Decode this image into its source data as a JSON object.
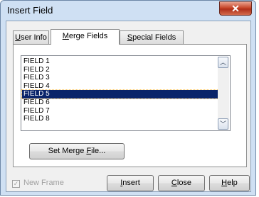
{
  "dialog": {
    "title": "Insert Field",
    "close_glyph": "✕"
  },
  "tabs": [
    {
      "label_ul": "U",
      "label_rest": "ser Info",
      "active": false
    },
    {
      "label_ul": "M",
      "label_rest": "erge Fields",
      "active": true
    },
    {
      "label_ul": "S",
      "label_rest": "pecial Fields",
      "active": false
    }
  ],
  "fields_list": {
    "items": [
      "FIELD 1",
      "FIELD 2",
      "FIELD 3",
      "FIELD 4",
      "FIELD 5",
      "FIELD 6",
      "FIELD 7",
      "FIELD 8"
    ],
    "selected": "FIELD 5",
    "scroll_up_glyph": "︿",
    "scroll_down_glyph": "﹀"
  },
  "set_merge_file_button": {
    "prefix": "Set Merge ",
    "underlined": "F",
    "suffix": "ile..."
  },
  "new_frame": {
    "label": "New Frame",
    "checked": true,
    "enabled": false,
    "check_glyph": "✓"
  },
  "buttons": {
    "insert": {
      "underlined": "I",
      "rest": "nsert"
    },
    "close": {
      "underlined": "C",
      "rest": "lose"
    },
    "help": {
      "underlined": "H",
      "rest": "elp"
    }
  },
  "colors": {
    "selection": "#0a246a",
    "dialog_frame": "#cfe0f3",
    "close_button": "#c8462a"
  }
}
